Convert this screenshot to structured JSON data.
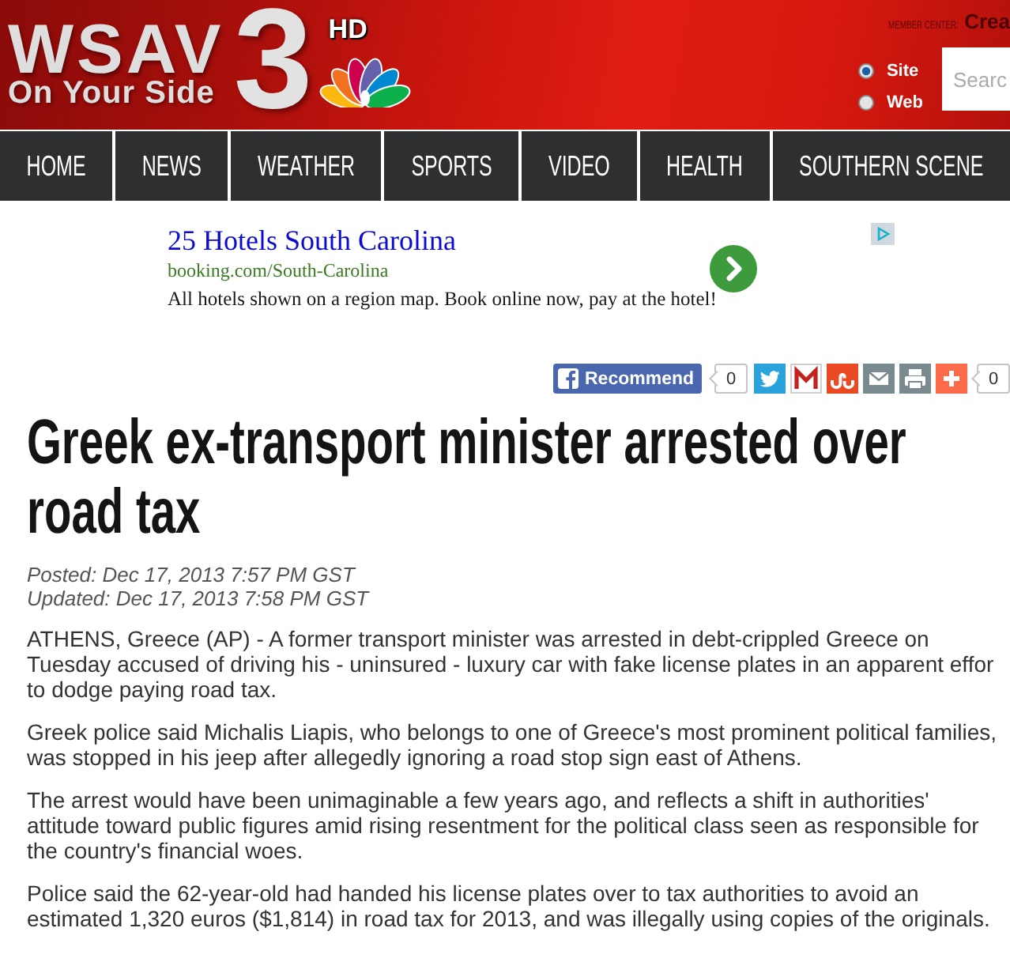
{
  "header": {
    "logo": {
      "wordmark": "WSAV",
      "tagline": "On Your Side",
      "channel": "3",
      "badge": "HD"
    },
    "member_center": {
      "label": "MEMBER CENTER:",
      "link": "Crea"
    },
    "search_scope": [
      {
        "label": "Site",
        "selected": true
      },
      {
        "label": "Web",
        "selected": false
      }
    ],
    "search": {
      "placeholder": "Searc"
    }
  },
  "nav": [
    {
      "label": "HOME"
    },
    {
      "label": "NEWS"
    },
    {
      "label": "WEATHER"
    },
    {
      "label": "SPORTS"
    },
    {
      "label": "VIDEO"
    },
    {
      "label": "HEALTH"
    },
    {
      "label": "SOUTHERN SCENE"
    }
  ],
  "ad": {
    "title": "25 Hotels South Carolina",
    "url": "booking.com/South-Carolina",
    "description": "All hotels shown on a region map. Book online now, pay at the hotel!"
  },
  "share_bar": {
    "recommend": {
      "label": "Recommend",
      "count": "0"
    },
    "total_count": "0"
  },
  "article": {
    "headline": "Greek ex-transport minister arrested over road tax",
    "posted": "Posted: Dec 17, 2013 7:57 PM GST",
    "updated": "Updated: Dec 17, 2013 7:58 PM GST",
    "paragraphs": [
      "ATHENS, Greece (AP) - A former transport minister was arrested in debt-crippled Greece on Tuesday accused of driving his - uninsured - luxury car with fake license plates in an apparent effor to dodge paying road tax.",
      "Greek police said Michalis Liapis, who belongs to one of Greece's most prominent political families, was stopped in his jeep after allegedly ignoring a road stop sign east of Athens.",
      "The arrest would have been unimaginable a few years ago, and reflects a shift in authorities' attitude toward public figures amid rising resentment for the political class seen as responsible for the country's financial woes.",
      "Police said the 62-year-old had handed his license plates over to tax authorities to avoid an estimated 1,320 euros ($1,814) in road tax for 2013, and was illegally using copies of the originals."
    ]
  }
}
